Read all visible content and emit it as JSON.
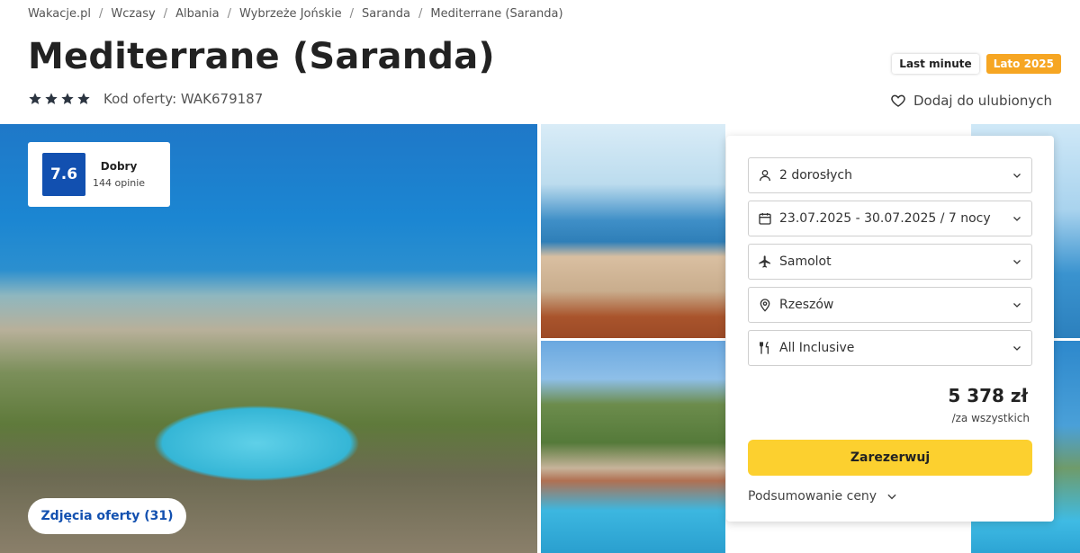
{
  "breadcrumb": [
    "Wakacje.pl",
    "Wczasy",
    "Albania",
    "Wybrzeże Jońskie",
    "Saranda",
    "Mediterrane (Saranda)"
  ],
  "title": "Mediterrane (Saranda)",
  "stars": 4,
  "offer_code": "Kod oferty: WAK679187",
  "badges": {
    "last_minute": "Last minute",
    "season": "Lato 2025",
    "season_color": "#f6a623"
  },
  "favorite_label": "Dodaj do ulubionych",
  "rating": {
    "score": "7.6",
    "label": "Dobry",
    "count": "144 opinie",
    "color": "#1250b0"
  },
  "photos_button": "Zdjęcia oferty (31)",
  "booking": {
    "guests": "2 dorosłych",
    "dates": "23.07.2025 - 30.07.2025 / 7 nocy",
    "transport": "Samolot",
    "departure": "Rzeszów",
    "board": "All Inclusive",
    "price": "5 378 zł",
    "price_note": "/za wszystkich",
    "book_label": "Zarezerwuj",
    "summary_label": "Podsumowanie ceny",
    "button_color": "#fcd02f"
  },
  "icons": {
    "star": "star-icon",
    "heart": "heart-icon",
    "person": "person-icon",
    "calendar": "calendar-icon",
    "plane": "plane-icon",
    "location": "location-pin-icon",
    "food": "cutlery-icon",
    "chevron": "chevron-down-icon"
  }
}
